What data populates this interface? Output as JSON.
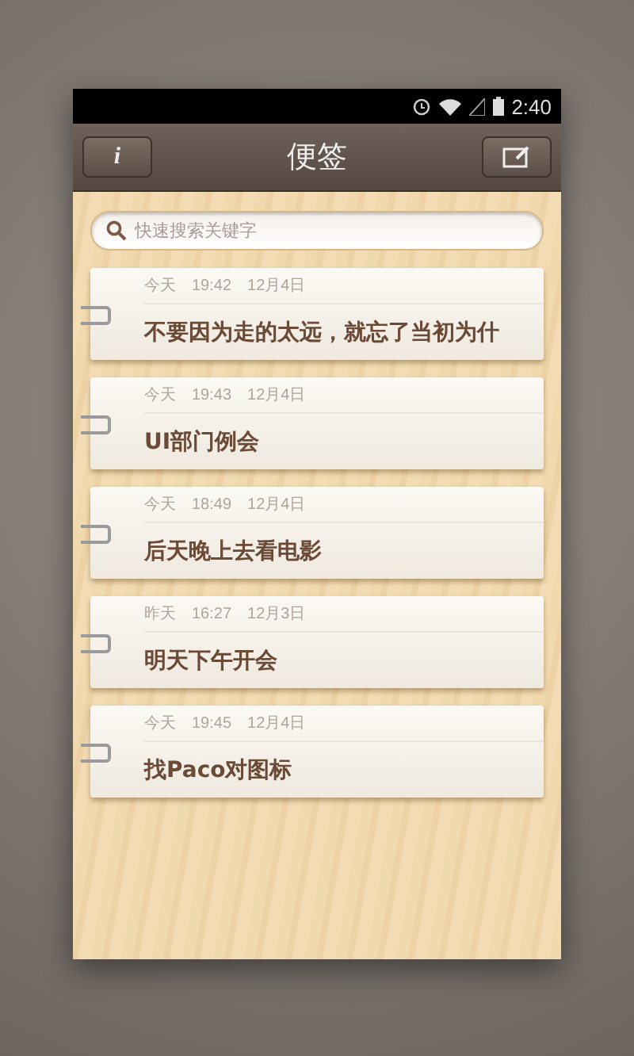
{
  "status_bar": {
    "time": "2:40"
  },
  "header": {
    "info_button": "i",
    "title": "便签"
  },
  "search": {
    "placeholder": "快速搜索关键字"
  },
  "notes": [
    {
      "day": "今天",
      "time": "19:42",
      "date": "12月4日",
      "text": "不要因为走的太远，就忘了当初为什"
    },
    {
      "day": "今天",
      "time": "19:43",
      "date": "12月4日",
      "text": "UI部门例会"
    },
    {
      "day": "今天",
      "time": "18:49",
      "date": "12月4日",
      "text": "后天晚上去看电影"
    },
    {
      "day": "昨天",
      "time": "16:27",
      "date": "12月3日",
      "text": "明天下午开会"
    },
    {
      "day": "今天",
      "time": "19:45",
      "date": "12月4日",
      "text": "找Paco对图标"
    }
  ]
}
